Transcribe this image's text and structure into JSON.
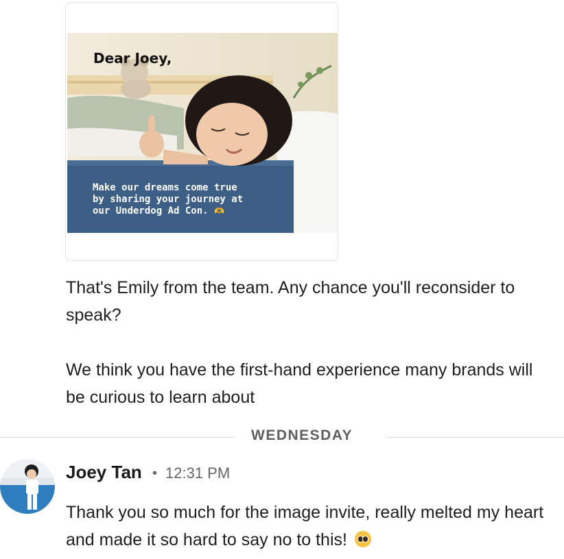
{
  "image_card": {
    "salutation": "Dear Joey,",
    "caption_text": "Make our dreams come true by sharing your journey at our Underdog Ad Con.",
    "caption_emoji_icon": "hands-heart-icon"
  },
  "message_1": {
    "paragraph_1": "That's Emily from the team. Any chance you'll reconsider to speak?",
    "paragraph_2": "We think you have the first-hand experience many brands will be curious to learn about"
  },
  "day_divider": {
    "label": "WEDNESDAY"
  },
  "message_2": {
    "sender": "Joey Tan",
    "separator": "•",
    "time": "12:31 PM",
    "text": "Thank you so much for the image invite, really melted my heart and made it so hard to say no to this!",
    "emoji_icon": "pleading-face-icon"
  },
  "colors": {
    "divider": "#dcdcdc",
    "text": "#1e1e1e",
    "muted": "#666666",
    "mattress_blue": "#3d5f86"
  }
}
